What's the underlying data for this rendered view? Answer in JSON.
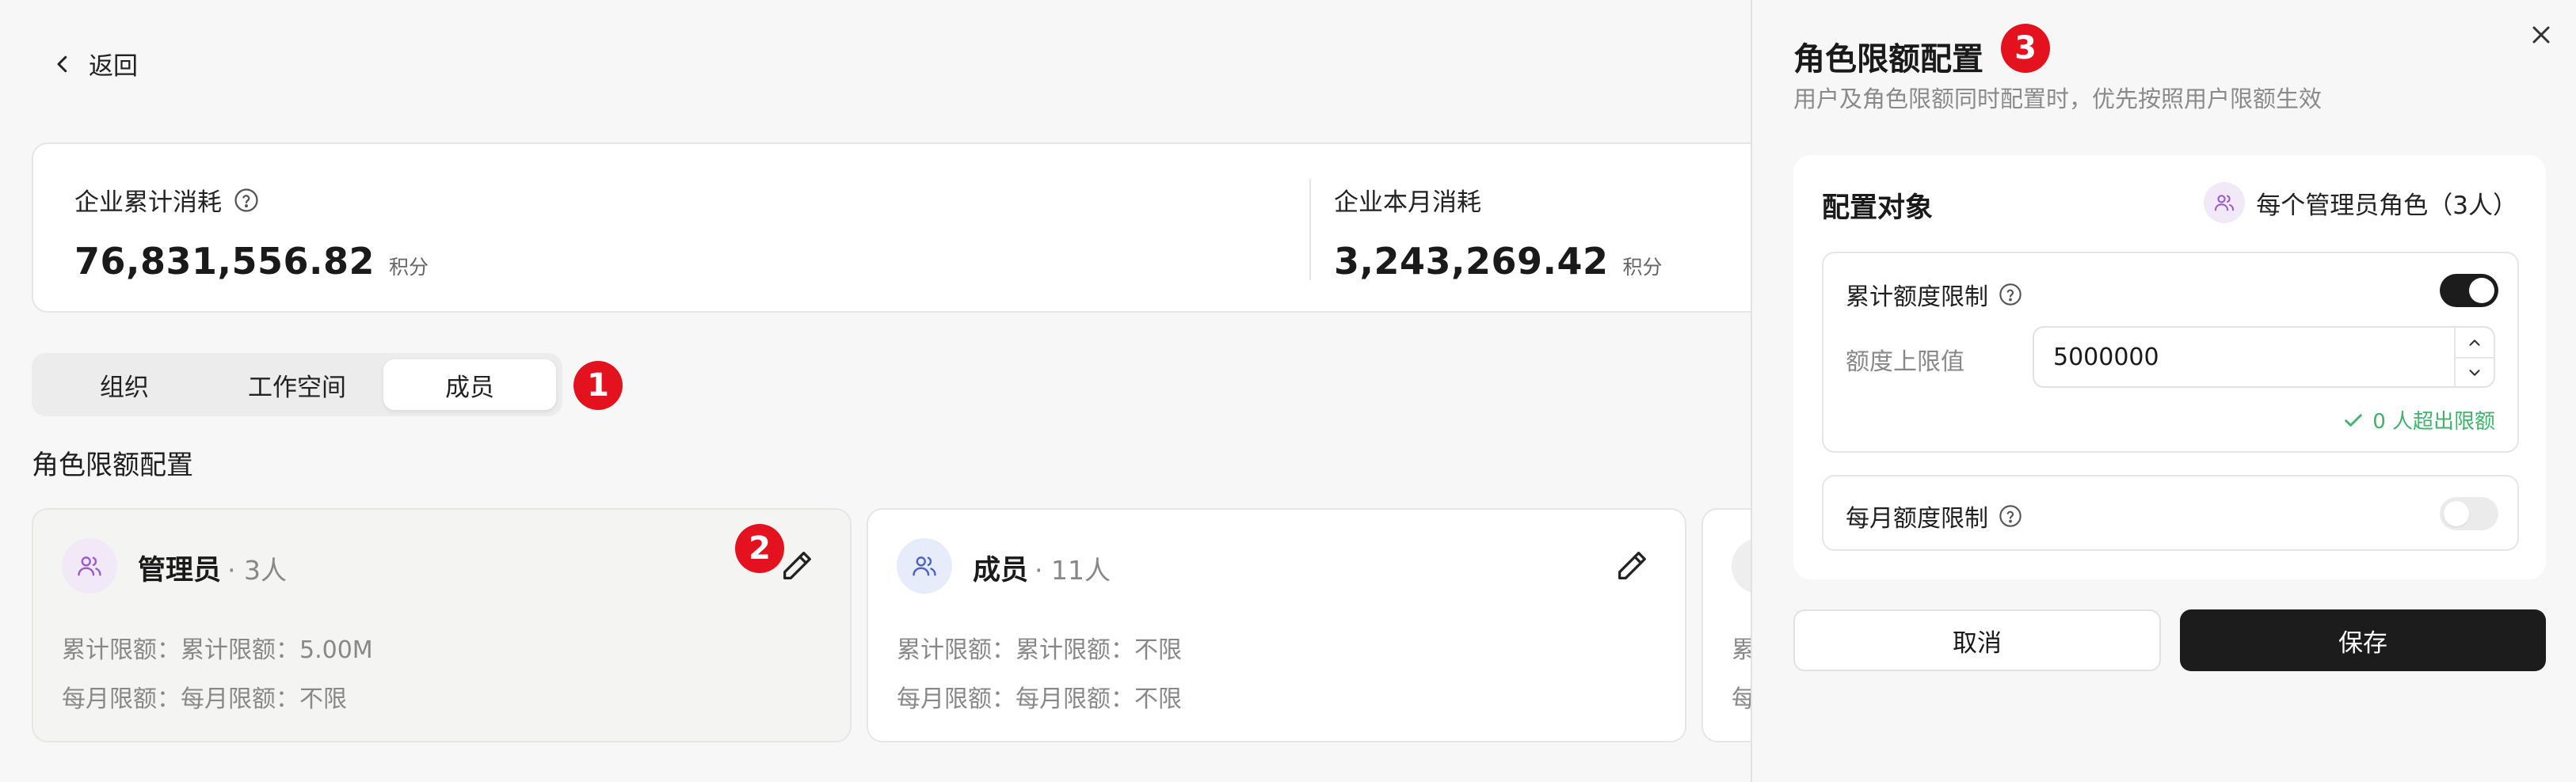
{
  "nav": {
    "back_label": "返回"
  },
  "stats": [
    {
      "label": "企业累计消耗",
      "value": "76,831,556.82",
      "unit": "积分",
      "has_help": true
    },
    {
      "label": "企业本月消耗",
      "value": "3,243,269.42",
      "unit": "积分",
      "has_help": false
    }
  ],
  "tabs": [
    {
      "label": "组织",
      "active": false
    },
    {
      "label": "工作空间",
      "active": false
    },
    {
      "label": "成员",
      "active": true
    }
  ],
  "annotations": {
    "badge1": "1",
    "badge2": "2",
    "badge3": "3"
  },
  "section_title": "角色限额配置",
  "roles": [
    {
      "name": "管理员",
      "count": "· 3人",
      "line1": "累计限额：累计限额：5.00M",
      "line2": "每月限额：每月限额：不限",
      "avatar_color": "#f1e8f8",
      "icon_color": "#9b5cc7"
    },
    {
      "name": "成员",
      "count": "· 11人",
      "line1": "累计限额：累计限额：不限",
      "line2": "每月限额：每月限额：不限",
      "avatar_color": "#e7ecfb",
      "icon_color": "#4a63c9"
    },
    {
      "line1": "累",
      "line2": "每"
    }
  ],
  "panel": {
    "title": "角色限额配置",
    "subtitle": "用户及角色限额同时配置时，优先按照用户限额生效",
    "config_title": "配置对象",
    "target_label": "每个管理员角色（3人）",
    "cumulative": {
      "label": "累计额度限制",
      "enabled": true,
      "field_label": "额度上限值",
      "value": "5000000",
      "status": "0 人超出限额"
    },
    "monthly": {
      "label": "每月额度限制",
      "enabled": false
    },
    "cancel_label": "取消",
    "save_label": "保存"
  },
  "colors": {
    "accent": "#1c1c1c",
    "success": "#3fb36b",
    "badge": "#e3121e"
  },
  "icons": [
    "chevron-left-icon",
    "help-circle-icon",
    "users-icon",
    "edit-pencil-icon",
    "close-icon",
    "chevron-up-icon",
    "chevron-down-icon",
    "check-icon"
  ]
}
